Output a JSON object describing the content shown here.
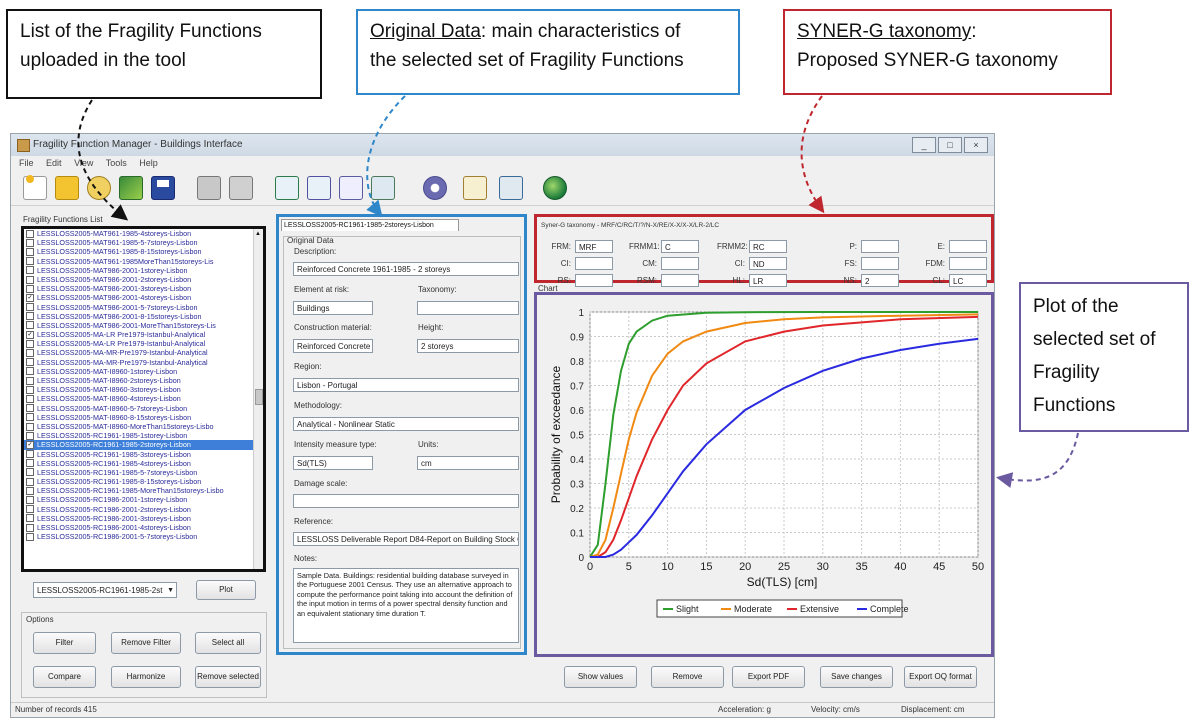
{
  "callouts": {
    "list": {
      "line1": "List of the Fragility Functions",
      "line2": "uploaded in the tool"
    },
    "original": {
      "line1_u": "Original Data",
      "line1_rest": ": main characteristics of",
      "line2": "the selected set of Fragility Functions"
    },
    "synerg": {
      "line1": "SYNER-G taxonomy",
      "line1_rest": ":",
      "line2": "Proposed SYNER-G taxonomy"
    },
    "plot": {
      "line1": "Plot of the",
      "line2": "selected set of",
      "line3": "Fragility",
      "line4": "Functions"
    }
  },
  "window": {
    "title": "Fragility Function Manager - Buildings Interface",
    "menu": [
      "File",
      "Edit",
      "View",
      "Tools",
      "Help"
    ],
    "controls": [
      "_",
      "□",
      "×"
    ]
  },
  "toolbar_icons": [
    "new-file-icon",
    "open-folder-icon",
    "database-icon",
    "chart-icon",
    "save-icon",
    "print-icon",
    "print-preview-icon",
    "export-icon",
    "export2-icon",
    "report-icon",
    "image-icon",
    "gear-icon",
    "edit-icon",
    "calculator-icon",
    "globe-icon"
  ],
  "list_panel": {
    "title": "Fragility Functions List",
    "items": [
      {
        "text": "LESSLOSS2005-MAT961-1985-4storeys-Lisbon",
        "checked": false
      },
      {
        "text": "LESSLOSS2005-MAT961-1985-5-7storeys-Lisbon",
        "checked": false
      },
      {
        "text": "LESSLOSS2005-MAT961-1985-8-15storeys-Lisbon",
        "checked": false
      },
      {
        "text": "LESSLOSS2005-MAT961-1985MoreThan15storeys-Lis",
        "checked": false
      },
      {
        "text": "LESSLOSS2005-MAT986-2001-1storey-Lisbon",
        "checked": false
      },
      {
        "text": "LESSLOSS2005-MAT986-2001-2storeys-Lisbon",
        "checked": false
      },
      {
        "text": "LESSLOSS2005-MAT986-2001-3storeys-Lisbon",
        "checked": false
      },
      {
        "text": "LESSLOSS2005-MAT986-2001-4storeys-Lisbon",
        "checked": true
      },
      {
        "text": "LESSLOSS2005-MAT986-2001-5-7storeys-Lisbon",
        "checked": false
      },
      {
        "text": "LESSLOSS2005-MAT986-2001-8-15storeys-Lisbon",
        "checked": false
      },
      {
        "text": "LESSLOSS2005-MAT986-2001-MoreThan15storeys-Lis",
        "checked": false
      },
      {
        "text": "LESSLOSS2005-MA-LR Pre1979-Istanbul-Analytical",
        "checked": true
      },
      {
        "text": "LESSLOSS2005-MA-LR Pre1979-Istanbul-Analytical",
        "checked": false
      },
      {
        "text": "LESSLOSS2005-MA-MR-Pre1979-Istanbul-Analytical",
        "checked": false
      },
      {
        "text": "LESSLOSS2005-MA-MR-Pre1979-Istanbul-Analytical",
        "checked": false
      },
      {
        "text": "LESSLOSS2005-MAT-I8960-1storey-Lisbon",
        "checked": false
      },
      {
        "text": "LESSLOSS2005-MAT-I8960-2storeys-Lisbon",
        "checked": false
      },
      {
        "text": "LESSLOSS2005-MAT-I8960-3storeys-Lisbon",
        "checked": false
      },
      {
        "text": "LESSLOSS2005-MAT-I8960-4storeys-Lisbon",
        "checked": false
      },
      {
        "text": "LESSLOSS2005-MAT-I8960-5-7storeys-Lisbon",
        "checked": false
      },
      {
        "text": "LESSLOSS2005-MAT-I8960-8-15storeys-Lisbon",
        "checked": false
      },
      {
        "text": "LESSLOSS2005-MAT-I8960-MoreThan15storeys-Lisbo",
        "checked": false
      },
      {
        "text": "LESSLOSS2005-RC1961-1985-1storey-Lisbon",
        "checked": false
      },
      {
        "text": "LESSLOSS2005-RC1961-1985-2storeys-Lisbon",
        "checked": true,
        "selected": true
      },
      {
        "text": "LESSLOSS2005-RC1961-1985-3storeys-Lisbon",
        "checked": false
      },
      {
        "text": "LESSLOSS2005-RC1961-1985-4storeys-Lisbon",
        "checked": false
      },
      {
        "text": "LESSLOSS2005-RC1961-1985-5-7storeys-Lisbon",
        "checked": false
      },
      {
        "text": "LESSLOSS2005-RC1961-1985-8-15storeys-Lisbon",
        "checked": false
      },
      {
        "text": "LESSLOSS2005-RC1961-1985-MoreThan15storeys-Lisbo",
        "checked": false
      },
      {
        "text": "LESSLOSS2005-RC1986-2001-1storey-Lisbon",
        "checked": false
      },
      {
        "text": "LESSLOSS2005-RC1986-2001-2storeys-Lisbon",
        "checked": false
      },
      {
        "text": "LESSLOSS2005-RC1986-2001-3storeys-Lisbon",
        "checked": false
      },
      {
        "text": "LESSLOSS2005-RC1986-2001-4storeys-Lisbon",
        "checked": false
      },
      {
        "text": "LESSLOSS2005-RC1986-2001-5-7storeys-Lisbon",
        "checked": false
      }
    ],
    "combo_value": "LESSLOSS2005-RC1961-1985-2st",
    "plot_button": "Plot"
  },
  "options": {
    "title": "Options",
    "filter": "Filter",
    "remove_filter": "Remove Filter",
    "select_all": "Select all",
    "compare": "Compare",
    "harmonize": "Harmonize",
    "remove_selected": "Remove selected"
  },
  "original_data": {
    "tab": "LESSLOSS2005-RC1961-1985-2storeys-Lisbon",
    "group": "Original Data",
    "description_label": "Description:",
    "description": "Reinforced Concrete 1961-1985 - 2 storeys",
    "element_label": "Element at risk:",
    "element": "Buildings",
    "taxonomy_label": "Taxonomy:",
    "taxonomy": "",
    "material_label": "Construction material:",
    "material": "Reinforced Concrete",
    "height_label": "Height:",
    "height": "2 storeys",
    "region_label": "Region:",
    "region": "Lisbon - Portugal",
    "methodology_label": "Methodology:",
    "methodology": "Analytical - Nonlinear Static",
    "im_label": "Intensity measure type:",
    "im": "Sd(TLS)",
    "units_label": "Units:",
    "units": "cm",
    "damage_label": "Damage scale:",
    "damage": "",
    "reference_label": "Reference:",
    "reference": "LESSLOSS Deliverable Report D84-Report on Building Stock C",
    "notes_label": "Notes:",
    "notes": "Sample Data. Buildings: residential building database surveyed in the Portuguese 2001 Census. They use an alternative approach to compute the performance point taking into account the definition of the input motion in terms of a power spectral density function and an equivalent stationary time duration T."
  },
  "taxonomy": {
    "title": "Syner-G taxonomy - MRF/C/RC/T/?/N-X/RE/X-X/X-X/LR-2/LC",
    "fields": [
      {
        "label": "FRM:",
        "value": "MRF"
      },
      {
        "label": "FRMM1:",
        "value": "C"
      },
      {
        "label": "FRMM2:",
        "value": "RC"
      },
      {
        "label": "P:",
        "value": ""
      },
      {
        "label": "E:",
        "value": ""
      },
      {
        "label": "CI:",
        "value": ""
      },
      {
        "label": "CM:",
        "value": ""
      },
      {
        "label": "CI:",
        "value": "ND"
      },
      {
        "label": "FS:",
        "value": ""
      },
      {
        "label": "FDM:",
        "value": ""
      },
      {
        "label": "RS:",
        "value": ""
      },
      {
        "label": "RSM:",
        "value": ""
      },
      {
        "label": "HL:",
        "value": "LR"
      },
      {
        "label": "NS:",
        "value": "2"
      },
      {
        "label": "CL:",
        "value": "LC"
      }
    ]
  },
  "chart_panel": {
    "title": "Chart"
  },
  "chart_data": {
    "type": "line",
    "xlabel": "Sd(TLS)  [cm]",
    "ylabel": "Probability of exceedance",
    "xlim": [
      0,
      50
    ],
    "ylim": [
      0,
      1
    ],
    "xticks": [
      0,
      5,
      10,
      15,
      20,
      25,
      30,
      35,
      40,
      45,
      50
    ],
    "yticks": [
      0,
      0.1,
      0.2,
      0.3,
      0.4,
      0.5,
      0.6,
      0.7,
      0.8,
      0.9,
      1
    ],
    "grid": true,
    "legend_position": "bottom",
    "series": [
      {
        "name": "Slight",
        "color": "#2e9e2e",
        "x": [
          0,
          1,
          2,
          3,
          4,
          5,
          6,
          8,
          10,
          15,
          20,
          30,
          50
        ],
        "y": [
          0,
          0.05,
          0.3,
          0.58,
          0.76,
          0.87,
          0.92,
          0.965,
          0.985,
          0.997,
          0.999,
          1,
          1
        ]
      },
      {
        "name": "Moderate",
        "color": "#f08a12",
        "x": [
          0,
          1,
          2,
          3,
          4,
          5,
          6,
          8,
          10,
          12,
          15,
          20,
          25,
          30,
          40,
          50
        ],
        "y": [
          0,
          0.01,
          0.07,
          0.2,
          0.34,
          0.48,
          0.59,
          0.74,
          0.83,
          0.88,
          0.92,
          0.955,
          0.97,
          0.978,
          0.985,
          0.99
        ]
      },
      {
        "name": "Extensive",
        "color": "#e0262a",
        "x": [
          0,
          1,
          2,
          3,
          4,
          5,
          6,
          8,
          10,
          12,
          15,
          20,
          25,
          30,
          40,
          50
        ],
        "y": [
          0,
          0,
          0.02,
          0.07,
          0.15,
          0.24,
          0.33,
          0.48,
          0.6,
          0.7,
          0.79,
          0.88,
          0.92,
          0.945,
          0.97,
          0.98
        ]
      },
      {
        "name": "Complete",
        "color": "#2a2ae0",
        "x": [
          0,
          1,
          2,
          3,
          4,
          5,
          6,
          8,
          10,
          12,
          15,
          20,
          25,
          30,
          35,
          40,
          45,
          50
        ],
        "y": [
          0,
          0,
          0,
          0.01,
          0.03,
          0.06,
          0.09,
          0.17,
          0.26,
          0.35,
          0.46,
          0.6,
          0.69,
          0.76,
          0.81,
          0.845,
          0.87,
          0.89
        ]
      }
    ]
  },
  "bottom_buttons": {
    "show_values": "Show values",
    "remove": "Remove",
    "export_pdf": "Export PDF",
    "save_changes": "Save changes",
    "export_oq": "Export OQ format"
  },
  "status": {
    "records": "Number of records 415",
    "acceleration": "Acceleration: g",
    "velocity": "Velocity: cm/s",
    "displacement": "Displacement: cm"
  }
}
